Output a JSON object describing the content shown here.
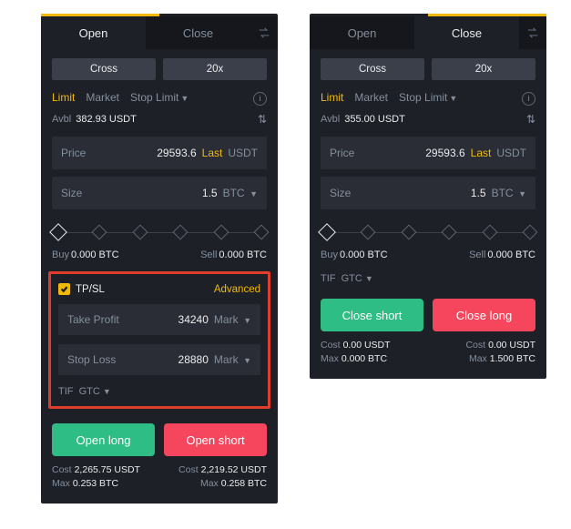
{
  "open": {
    "tabs": {
      "open": "Open",
      "close": "Close"
    },
    "mode": {
      "margin": "Cross",
      "leverage": "20x"
    },
    "otypes": {
      "limit": "Limit",
      "market": "Market",
      "stoplimit": "Stop Limit"
    },
    "avbl": {
      "label": "Avbl",
      "value": "382.93 USDT"
    },
    "price": {
      "label": "Price",
      "value": "29593.6",
      "last": "Last",
      "unit": "USDT"
    },
    "size": {
      "label": "Size",
      "value": "1.5",
      "unit": "BTC"
    },
    "readout": {
      "buyLabel": "Buy",
      "buyValue": "0.000 BTC",
      "sellLabel": "Sell",
      "sellValue": "0.000 BTC"
    },
    "tpsl": {
      "label": "TP/SL",
      "advanced": "Advanced",
      "tp": {
        "label": "Take Profit",
        "value": "34240",
        "unit": "Mark"
      },
      "sl": {
        "label": "Stop Loss",
        "value": "28880",
        "unit": "Mark"
      }
    },
    "tif": {
      "label": "TIF",
      "value": "GTC"
    },
    "actions": {
      "long": "Open long",
      "short": "Open short"
    },
    "footer": {
      "left": {
        "costLabel": "Cost",
        "costValue": "2,265.75 USDT",
        "maxLabel": "Max",
        "maxValue": "0.253 BTC"
      },
      "right": {
        "costLabel": "Cost",
        "costValue": "2,219.52 USDT",
        "maxLabel": "Max",
        "maxValue": "0.258 BTC"
      }
    }
  },
  "close": {
    "tabs": {
      "open": "Open",
      "close": "Close"
    },
    "mode": {
      "margin": "Cross",
      "leverage": "20x"
    },
    "otypes": {
      "limit": "Limit",
      "market": "Market",
      "stoplimit": "Stop Limit"
    },
    "avbl": {
      "label": "Avbl",
      "value": "355.00 USDT"
    },
    "price": {
      "label": "Price",
      "value": "29593.6",
      "last": "Last",
      "unit": "USDT"
    },
    "size": {
      "label": "Size",
      "value": "1.5",
      "unit": "BTC"
    },
    "readout": {
      "buyLabel": "Buy",
      "buyValue": "0.000 BTC",
      "sellLabel": "Sell",
      "sellValue": "0.000 BTC"
    },
    "tif": {
      "label": "TIF",
      "value": "GTC"
    },
    "actions": {
      "short": "Close short",
      "long": "Close long"
    },
    "footer": {
      "left": {
        "costLabel": "Cost",
        "costValue": "0.00 USDT",
        "maxLabel": "Max",
        "maxValue": "0.000 BTC"
      },
      "right": {
        "costLabel": "Cost",
        "costValue": "0.00 USDT",
        "maxLabel": "Max",
        "maxValue": "1.500 BTC"
      }
    }
  }
}
